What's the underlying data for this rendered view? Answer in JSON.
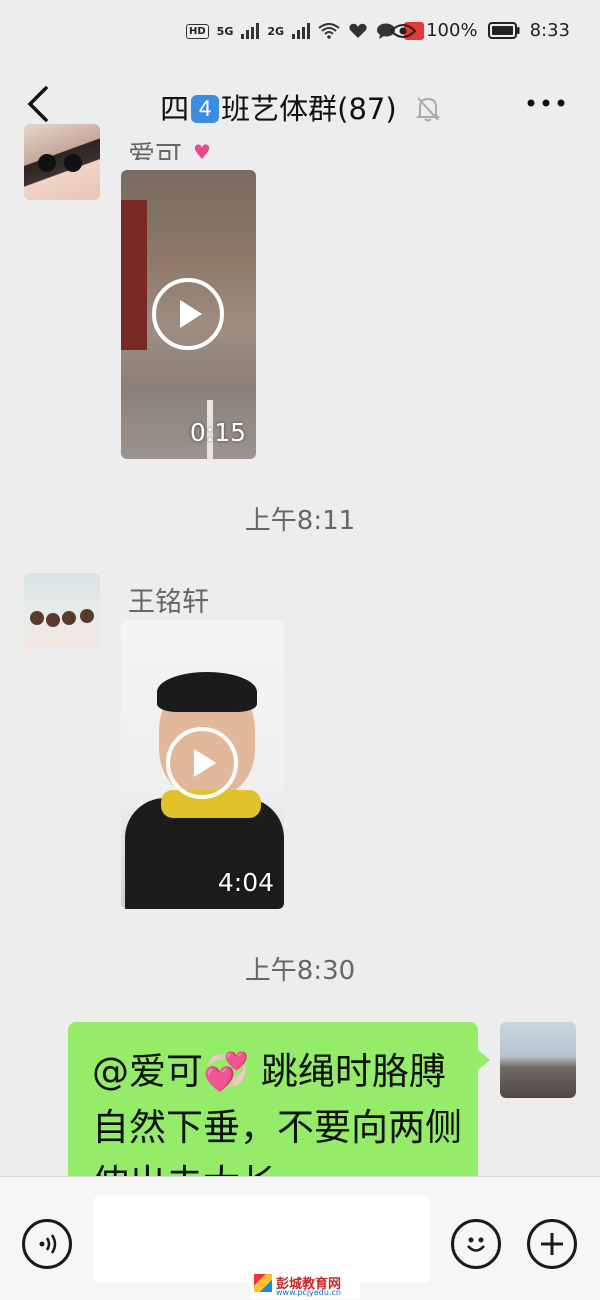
{
  "status_bar": {
    "network_left": "HD",
    "net1": "5G",
    "net2": "2G",
    "battery": "100%",
    "clock": "8:33"
  },
  "header": {
    "title_prefix": "四",
    "title_badge": "4",
    "title_suffix": "班艺体群(87)"
  },
  "messages": [
    {
      "sender": "爱可",
      "type": "video",
      "duration": "0:15"
    },
    {
      "timestamp": "上午8:11"
    },
    {
      "sender": "王铭轩",
      "type": "video",
      "duration": "4:04"
    },
    {
      "timestamp": "上午8:30"
    },
    {
      "type": "text",
      "outgoing": true,
      "text": "@爱可💞  跳绳时胳膊自然下垂，不要向两侧伸出去太长"
    }
  ],
  "watermark": {
    "site": "彭城教育网",
    "url": "www.pcjyedu.cn"
  },
  "colors": {
    "bg": "#ededed",
    "bubble": "#95ec69",
    "badge": "#3b8de0"
  }
}
